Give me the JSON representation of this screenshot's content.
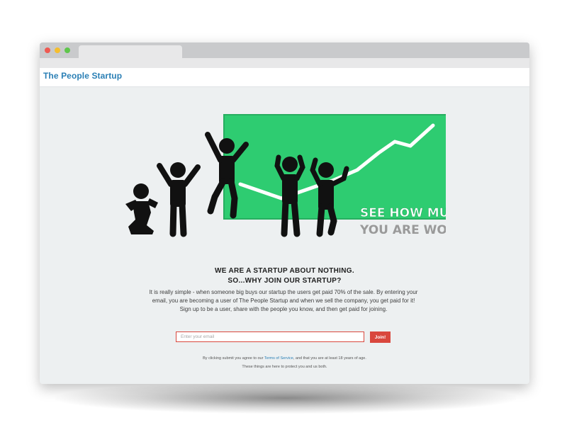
{
  "browser": {
    "traffic_lights": [
      "close",
      "minimize",
      "maximize"
    ],
    "colors": {
      "close": "#ee5a52",
      "minimize": "#f5be2e",
      "maximize": "#5fc64b"
    }
  },
  "navbar": {
    "brand": "The People Startup",
    "brand_color": "#2a7fb5"
  },
  "hero": {
    "line1": "SEE HOW MUCH $",
    "line2": "YOU ARE WORTH!",
    "chart_color": "#2ecc71",
    "figure_count": 5
  },
  "content": {
    "headline1": "WE ARE A STARTUP ABOUT NOTHING.",
    "headline2": "SO...WHY JOIN OUR STARTUP?",
    "body": "It is really simple - when someone big buys our startup the users get paid 70% of the sale. By entering your email, you are becoming a user of The People Startup and when we sell the company, you get paid for it! Sign up to be a user, share with the people you know, and then get paid for joining."
  },
  "signup": {
    "email_placeholder": "Enter your email",
    "join_label": "Join!",
    "accent_color": "#d9473d"
  },
  "terms": {
    "prefix": "By clicking submit you agree to our ",
    "link": "Terms of Service",
    "suffix": ", and that you are at least 18 years of age.",
    "line2": "These things are here to protect you and us both."
  }
}
